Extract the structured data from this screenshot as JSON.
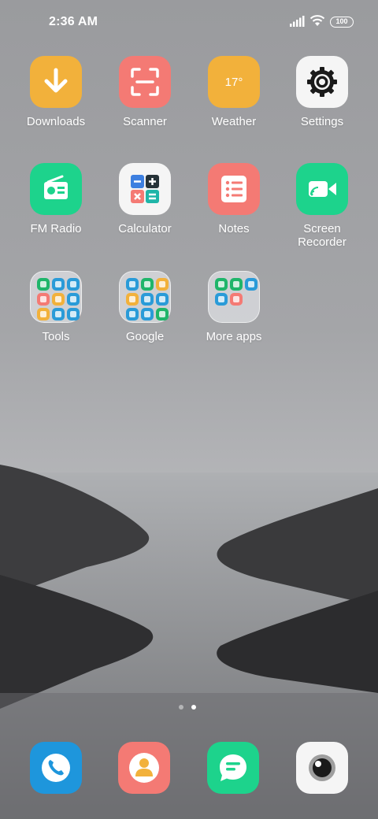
{
  "status_bar": {
    "time": "2:36 AM",
    "battery": "100"
  },
  "apps": [
    {
      "label": "Downloads",
      "icon": "download-icon",
      "color": "#f2b13b"
    },
    {
      "label": "Scanner",
      "icon": "scanner-icon",
      "color": "#f47a74"
    },
    {
      "label": "Weather",
      "icon": "weather-icon",
      "color": "#f2b13b",
      "icon_text": "17°"
    },
    {
      "label": "Settings",
      "icon": "gear-icon",
      "color": "#f5f5f5"
    },
    {
      "label": "FM Radio",
      "icon": "radio-icon",
      "color": "#1dd38c"
    },
    {
      "label": "Calculator",
      "icon": "calculator-icon",
      "color": "#f5f5f5"
    },
    {
      "label": "Notes",
      "icon": "notes-icon",
      "color": "#f47a74"
    },
    {
      "label_line1": "Screen",
      "label_line2": "Recorder",
      "icon": "screen-recorder-icon",
      "color": "#1dd38c"
    }
  ],
  "folders": [
    {
      "label": "Tools",
      "mini_colors": [
        "#1fb56a",
        "#2a9bd8",
        "#2a9bd8",
        "#f47a74",
        "#f2b13b",
        "#2a9bd8",
        "#f2b13b",
        "#2a9bd8",
        "#2a9bd8"
      ]
    },
    {
      "label": "Google",
      "mini_colors": [
        "#2a9bd8",
        "#1fb56a",
        "#f2b13b",
        "#f2b13b",
        "#2a9bd8",
        "#2a9bd8",
        "#2a9bd8",
        "#2a9bd8",
        "#1fb56a"
      ]
    },
    {
      "label": "More apps",
      "mini_colors": [
        "#1fb56a",
        "#1fb56a",
        "#2a9bd8",
        "#2a9bd8",
        "#f47a74"
      ]
    }
  ],
  "dock": [
    {
      "icon": "phone-icon",
      "color": "#1e96dc"
    },
    {
      "icon": "contacts-icon",
      "color": "#f47a74"
    },
    {
      "icon": "messages-icon",
      "color": "#1dd38c"
    },
    {
      "icon": "camera-icon",
      "color": "#f5f5f5"
    }
  ],
  "page_indicator": {
    "pages": 2,
    "active": 2
  }
}
